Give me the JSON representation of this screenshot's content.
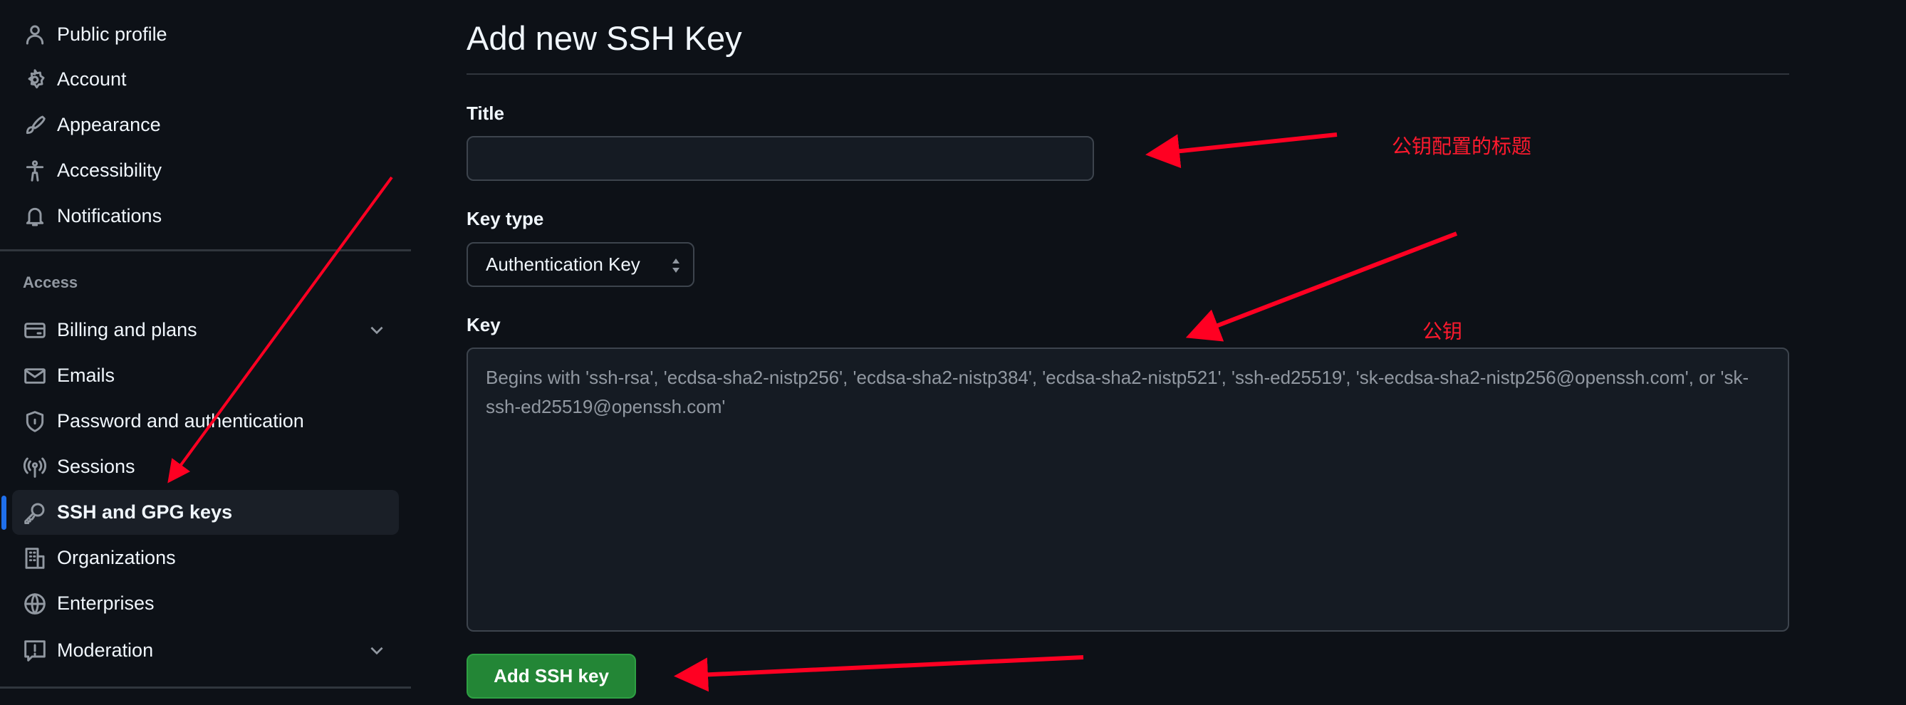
{
  "sidebar": {
    "items": [
      {
        "label": "Public profile",
        "icon": "person-icon"
      },
      {
        "label": "Account",
        "icon": "gear-icon"
      },
      {
        "label": "Appearance",
        "icon": "paintbrush-icon"
      },
      {
        "label": "Accessibility",
        "icon": "accessibility-icon"
      },
      {
        "label": "Notifications",
        "icon": "bell-icon"
      }
    ],
    "section_label": "Access",
    "access_items": [
      {
        "label": "Billing and plans",
        "icon": "credit-card-icon"
      },
      {
        "label": "Emails",
        "icon": "mail-icon"
      },
      {
        "label": "Password and authentication",
        "icon": "shield-lock-icon"
      },
      {
        "label": "Sessions",
        "icon": "broadcast-icon"
      },
      {
        "label": "SSH and GPG keys",
        "icon": "key-icon",
        "active": true
      },
      {
        "label": "Organizations",
        "icon": "organization-icon"
      },
      {
        "label": "Enterprises",
        "icon": "globe-icon"
      },
      {
        "label": "Moderation",
        "icon": "report-icon"
      }
    ]
  },
  "main": {
    "heading": "Add new SSH Key",
    "title_label": "Title",
    "title_value": "",
    "key_type_label": "Key type",
    "key_type_value": "Authentication Key",
    "key_label": "Key",
    "key_placeholder": "Begins with 'ssh-rsa', 'ecdsa-sha2-nistp256', 'ecdsa-sha2-nistp384', 'ecdsa-sha2-nistp521', 'ssh-ed25519', 'sk-ecdsa-sha2-nistp256@openssh.com', or 'sk-ssh-ed25519@openssh.com'",
    "submit_label": "Add SSH key"
  },
  "annotations": {
    "title_note": "公钥配置的标题",
    "key_note": "公钥",
    "color": "#ff0022"
  },
  "colors": {
    "background": "#0d1117",
    "accent": "#1f6feb",
    "primary_button": "#238636"
  }
}
